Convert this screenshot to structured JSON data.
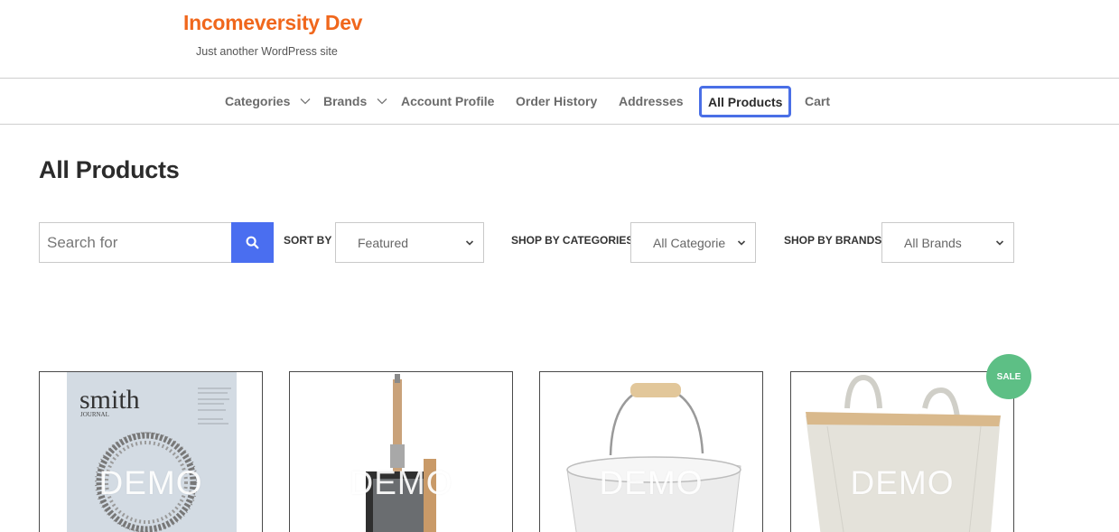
{
  "site": {
    "title": "Incomeversity Dev",
    "tagline": "Just another WordPress site"
  },
  "nav": {
    "items": [
      {
        "label": "Categories",
        "has_dropdown": true
      },
      {
        "label": "Brands",
        "has_dropdown": true
      },
      {
        "label": "Account Profile"
      },
      {
        "label": "Order History"
      },
      {
        "label": "Addresses"
      },
      {
        "label": "All Products",
        "active": true
      },
      {
        "label": "Cart"
      }
    ],
    "active_border_color": "#4a6fe6"
  },
  "page": {
    "title": "All Products"
  },
  "filters": {
    "search": {
      "placeholder": "Search for",
      "value": "",
      "button_icon": "search-icon",
      "button_color": "#4a6ef0"
    },
    "sort_by": {
      "label": "SORT BY",
      "value": "Featured"
    },
    "categories": {
      "label": "SHOP BY CATEGORIES",
      "value": "All Categorie"
    },
    "brands": {
      "label": "SHOP BY BRANDS",
      "value": "All Brands"
    }
  },
  "products": [
    {
      "image": "smith-journal-magazine",
      "watermark": "DEMO",
      "cover_title": "smith",
      "cover_subtitle": "JOURNAL"
    },
    {
      "image": "dustpan",
      "watermark": "DEMO"
    },
    {
      "image": "enamel-bucket",
      "watermark": "DEMO"
    },
    {
      "image": "canvas-basket",
      "watermark": "DEMO",
      "badge": "SALE",
      "badge_color": "#5dbf85"
    }
  ],
  "colors": {
    "brand": "#f0671c",
    "accent": "#4a6ef0"
  }
}
